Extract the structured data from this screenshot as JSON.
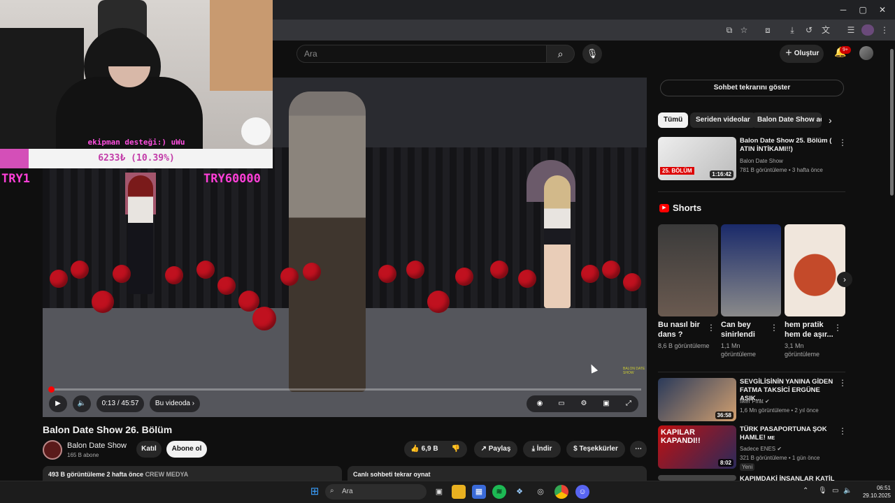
{
  "header": {
    "search_placeholder": "Ara",
    "create_label": "Oluştur",
    "notification_count": "9+"
  },
  "overlay": {
    "donation_message": "ekipman desteği:) uWu",
    "donation_progress_text": "6233₺ (10.39%)",
    "donation_progress_fraction": 0.1039,
    "goal_left": "TRY1",
    "goal_right": "TRY60000"
  },
  "player": {
    "time": "0:13 / 45:57",
    "in_video_label": "Bu videoda",
    "progress_fraction": 0.005,
    "watermark_in_video": "BALON DATE SHOW"
  },
  "video": {
    "title": "Balon Date Show 26. Bölüm",
    "channel_name": "Balon Date Show",
    "channel_subs": "165 B abone",
    "join_label": "Katıl",
    "subscribe_label": "Abone ol",
    "likes": "6,9 B",
    "share_label": "Paylaş",
    "download_label": "İndir",
    "thanks_label": "Teşekkürler",
    "views_date": "493 B görüntüleme  2 hafta önce",
    "hashtag": "CREW MEDYA",
    "chat_replay_bottom": "Canlı sohbeti tekrar oynat"
  },
  "sidebar": {
    "chat_replay_label": "Sohbet tekrarını göster",
    "chips": [
      "Tümü",
      "Seriden videolar",
      "Balon Date Show adl"
    ],
    "first_video": {
      "title": "Balon Date Show 25. Bölüm ( ATIN İNTİKAMI!!)",
      "channel": "Balon Date Show",
      "meta": "781 B görüntüleme • 3 hafta önce",
      "duration": "1:16:42",
      "thumb_badge": "25. BÖLÜM"
    },
    "shorts_heading": "Shorts",
    "shorts": [
      {
        "title": "Bu nasıl bir dans ?",
        "views": "8,6 B görüntüleme"
      },
      {
        "title": "Can bey sinirlendi",
        "views": "1,1 Mn görüntüleme"
      },
      {
        "title": "hem pratik hem de aşır...",
        "views": "3,1 Mn görüntüleme"
      }
    ],
    "videos": [
      {
        "title": "SEVGİLİSİNİN YANINA GİDEN FATMA TAKSİCİ ERGÜNE ASIK...",
        "channel": "İlker Fırat",
        "meta": "1,6 Mn görüntüleme • 2 yıl önce",
        "duration": "36:58"
      },
      {
        "title": "TÜRK PASAPORTUNA ŞOK HAMLE!",
        "title_suffix": "ME",
        "channel": "Sadece ENES",
        "meta": "321 B görüntüleme • 1 gün önce",
        "duration": "8:02",
        "badge": "Yeni",
        "thumb_text": "KAPILAR KAPANDI!!"
      },
      {
        "title": "KAPIMDAKİ İNSANLAR KATİL"
      }
    ]
  },
  "taskbar": {
    "search_label": "Ara",
    "time": "06:51",
    "date": "29.10.2025"
  },
  "colors": {
    "youtube_red": "#ff0000",
    "background": "#0f0f0f",
    "donation_pink": "#d44fb8"
  }
}
